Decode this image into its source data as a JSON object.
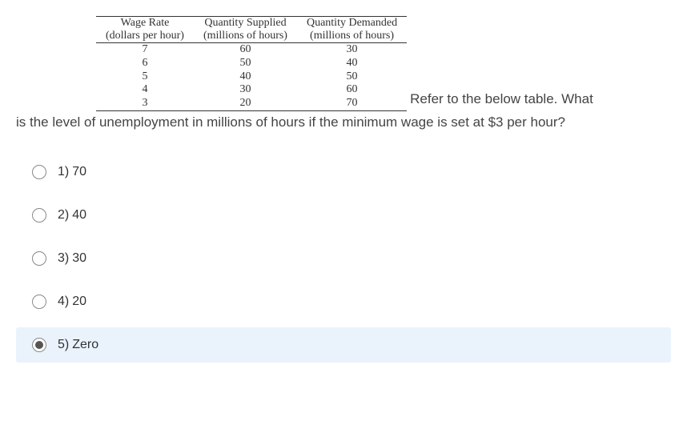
{
  "table": {
    "headers": [
      {
        "title": "Wage Rate",
        "sub": "(dollars per hour)"
      },
      {
        "title": "Quantity Supplied",
        "sub": "(millions of hours)"
      },
      {
        "title": "Quantity Demanded",
        "sub": "(millions of hours)"
      }
    ],
    "rows": [
      [
        "7",
        "60",
        "30"
      ],
      [
        "6",
        "50",
        "40"
      ],
      [
        "5",
        "40",
        "50"
      ],
      [
        "4",
        "30",
        "60"
      ],
      [
        "3",
        "20",
        "70"
      ]
    ]
  },
  "question": {
    "inline_text": "Refer to the below table. What",
    "rest_text": "is the level of unemployment in millions of hours if the minimum wage is set at $3 per hour?"
  },
  "options": [
    {
      "num": "1)",
      "text": "70",
      "selected": false
    },
    {
      "num": "2)",
      "text": "40",
      "selected": false
    },
    {
      "num": "3)",
      "text": "30",
      "selected": false
    },
    {
      "num": "4)",
      "text": "20",
      "selected": false
    },
    {
      "num": "5)",
      "text": "Zero",
      "selected": true
    }
  ],
  "chart_data": {
    "type": "table",
    "columns": [
      "Wage Rate (dollars per hour)",
      "Quantity Supplied (millions of hours)",
      "Quantity Demanded (millions of hours)"
    ],
    "data": [
      [
        7,
        60,
        30
      ],
      [
        6,
        50,
        40
      ],
      [
        5,
        40,
        50
      ],
      [
        4,
        30,
        60
      ],
      [
        3,
        20,
        70
      ]
    ]
  }
}
